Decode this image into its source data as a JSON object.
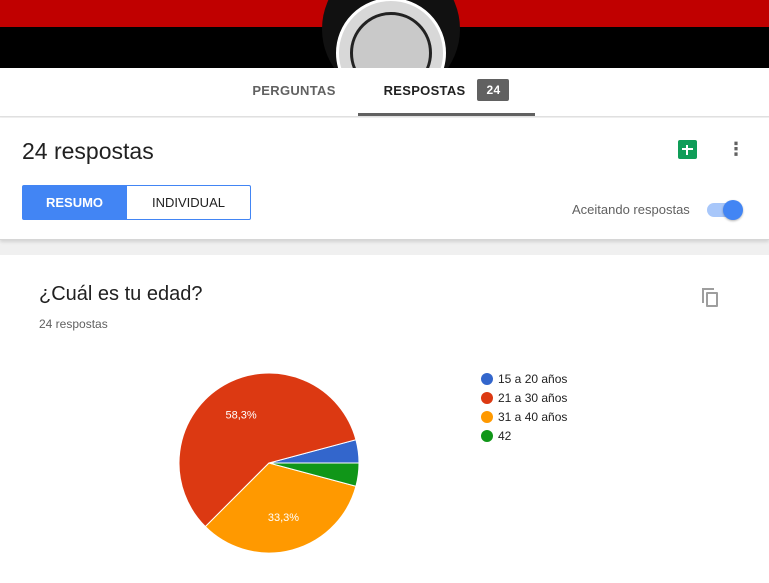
{
  "tabs": {
    "perguntas": "PERGUNTAS",
    "respostas": "RESPOSTAS",
    "respostas_count": "24"
  },
  "summary": {
    "title": "24 respostas",
    "resumo": "RESUMO",
    "individual": "INDIVIDUAL",
    "accepting_label": "Aceitando respostas",
    "accepting_on": true
  },
  "question": {
    "title": "¿Cuál es tu edad?",
    "count": "24 respostas"
  },
  "colors": {
    "accent": "#4285f4",
    "sheets": "#0f9d58"
  },
  "chart_data": {
    "type": "pie",
    "categories": [
      "15 a 20 años",
      "21 a 30 años",
      "31 a 40 años",
      "42"
    ],
    "values": [
      1,
      14,
      8,
      1
    ],
    "percent_labels": [
      "",
      "58,3%",
      "33,3%",
      ""
    ],
    "colors": [
      "#3366cc",
      "#dc3912",
      "#ff9900",
      "#109618"
    ],
    "legend": "right"
  }
}
